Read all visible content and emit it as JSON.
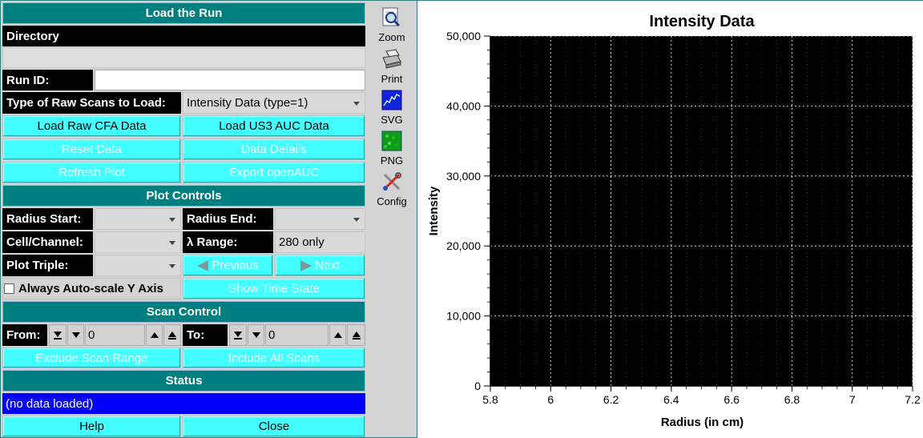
{
  "load": {
    "header": "Load the Run",
    "directory_label": "Directory",
    "directory_value": "",
    "run_id_label": "Run ID:",
    "run_id_value": "",
    "type_label": "Type of Raw Scans to Load:",
    "type_value": "Intensity Data (type=1)",
    "load_cfa": "Load Raw CFA Data",
    "load_us3": "Load US3 AUC Data",
    "reset": "Reset Data",
    "details": "Data Details",
    "refresh": "Refresh Plot",
    "export": "Export openAUC"
  },
  "plot_controls": {
    "header": "Plot Controls",
    "radius_start_label": "Radius Start:",
    "radius_start_value": "",
    "radius_end_label": "Radius End:",
    "radius_end_value": "",
    "cell_label": "Cell/Channel:",
    "cell_value": "",
    "lambda_label": "λ Range:",
    "lambda_value": "280 only",
    "triple_label": "Plot Triple:",
    "triple_value": "",
    "previous": "Previous",
    "next": "Next",
    "autoscale_label": "Always Auto-scale Y Axis",
    "autoscale_checked": false,
    "time_state": "Show Time State"
  },
  "scan_control": {
    "header": "Scan Control",
    "from_label": "From:",
    "from_value": "0",
    "to_label": "To:",
    "to_value": "0",
    "exclude": "Exclude Scan Range",
    "include": "Include All Scans"
  },
  "status": {
    "header": "Status",
    "text": "(no data loaded)"
  },
  "footer": {
    "help": "Help",
    "close": "Close"
  },
  "toolbar": [
    {
      "label": "Zoom",
      "icon": "zoom-icon"
    },
    {
      "label": "Print",
      "icon": "print-icon"
    },
    {
      "label": "SVG",
      "icon": "svg-icon"
    },
    {
      "label": "PNG",
      "icon": "png-icon"
    },
    {
      "label": "Config",
      "icon": "config-icon"
    }
  ],
  "colors": {
    "header": "#007f80",
    "button": "#44ffff",
    "status": "#0000ff",
    "plot_bg": "#000000"
  },
  "chart_data": {
    "type": "line",
    "title": "Intensity Data",
    "xlabel": "Radius (in cm)",
    "ylabel": "Intensity",
    "xlim": [
      5.8,
      7.2
    ],
    "ylim": [
      0,
      50000
    ],
    "xticks": [
      "5.8",
      "6",
      "6.2",
      "6.4",
      "6.6",
      "6.8",
      "7",
      "7.2"
    ],
    "yticks": [
      "0",
      "10,000",
      "20,000",
      "30,000",
      "40,000",
      "50,000"
    ],
    "series": [],
    "grid": true
  }
}
